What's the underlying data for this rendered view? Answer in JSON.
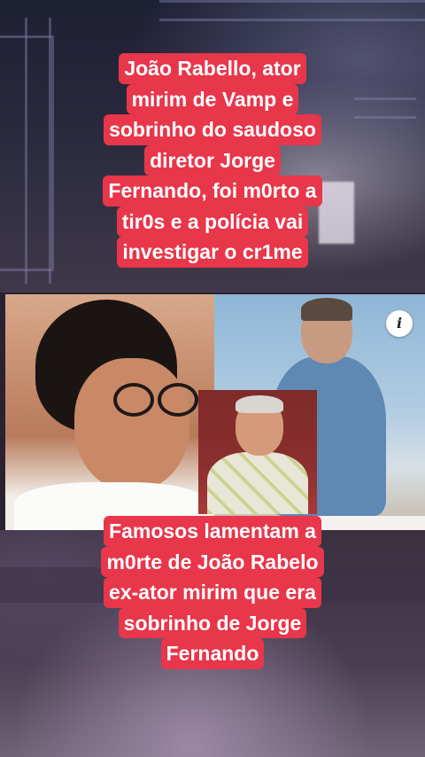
{
  "caption_top": [
    "João Rabello, ator",
    "mirim de Vamp e",
    "sobrinho do saudoso",
    "diretor Jorge",
    "Fernando, foi m0rto a",
    "tir0s e a polícia vai",
    "investigar o cr1me"
  ],
  "caption_bottom": [
    "Famosos lamentam a",
    "m0rte de João Rabelo",
    "ex-ator mirim que era",
    "sobrinho de Jorge",
    "Fernando"
  ],
  "info_icon": "i",
  "colors": {
    "caption_bg": "#e8364a",
    "caption_text": "#ffffff"
  }
}
